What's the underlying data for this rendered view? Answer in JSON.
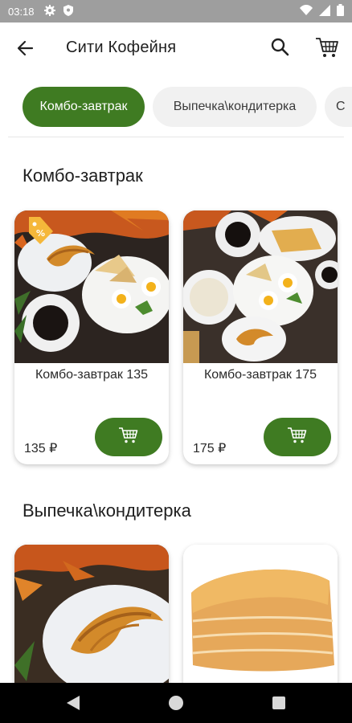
{
  "status_bar": {
    "time": "03:18",
    "icons": [
      "gear-icon",
      "shield-icon",
      "wifi-icon",
      "signal-icon",
      "battery-icon"
    ]
  },
  "app_bar": {
    "title": "Сити Кофейня",
    "icons": [
      "back-arrow-icon",
      "search-icon",
      "cart-icon"
    ]
  },
  "categories": [
    {
      "label": "Комбо-завтрак",
      "active": true
    },
    {
      "label": "Выпечка\\кондитерка",
      "active": false
    },
    {
      "label": "С",
      "active": false
    }
  ],
  "sections": [
    {
      "title": "Комбо-завтрак",
      "products": [
        {
          "name": "Комбо-завтрак 135",
          "price": "135 ₽",
          "badge": "discount-tag-icon",
          "image": "breakfast-croissant-eggs-coffee-photo"
        },
        {
          "name": "Комбо-завтрак 175",
          "price": "175 ₽",
          "image": "breakfast-porridge-eggs-croissant-photo"
        }
      ]
    },
    {
      "title": "Выпечка\\кондитерка",
      "products": [
        {
          "image": "croissant-photo"
        },
        {
          "image": "puff-pastry-photo"
        }
      ]
    }
  ],
  "colors": {
    "accent": "#3f7b22",
    "chip_inactive": "#f1f1f1",
    "status_bar": "#9e9e9e",
    "nav_bar": "#000000"
  },
  "nav_bar": {
    "icons": [
      "nav-back-icon",
      "nav-home-icon",
      "nav-recents-icon"
    ]
  }
}
